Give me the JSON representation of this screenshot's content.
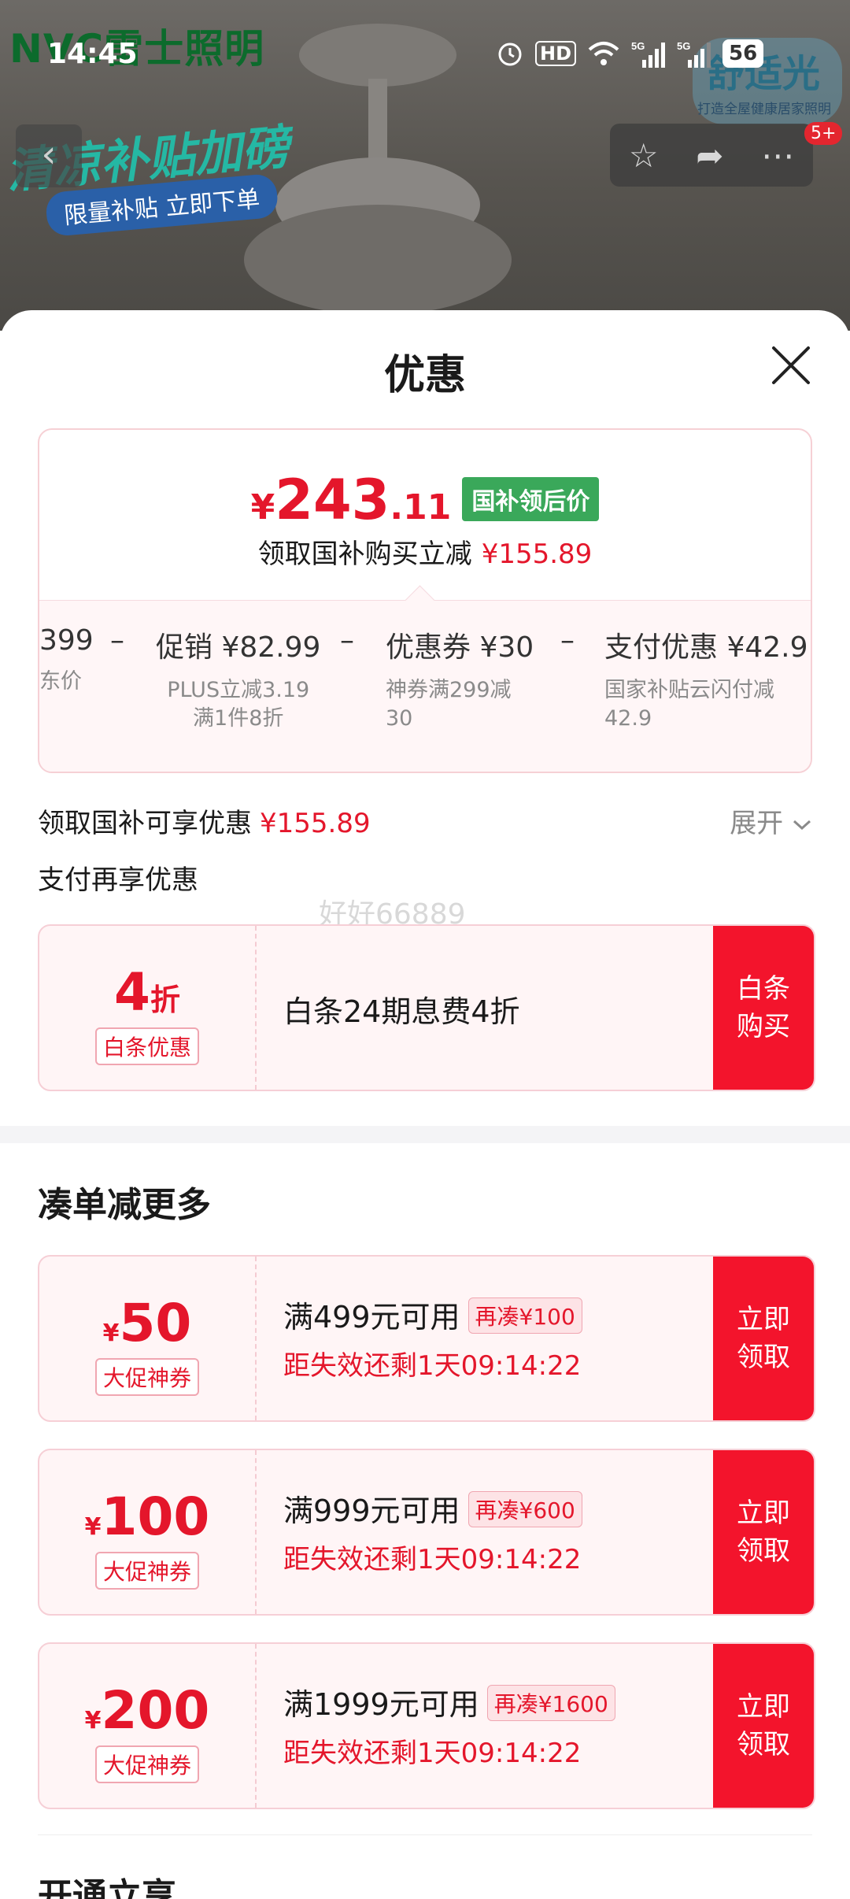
{
  "status_bar": {
    "time": "14:45",
    "icons": [
      "alarm-icon",
      "hd-icon",
      "wifi-icon",
      "signal-5g-icon",
      "signal-5g-icon"
    ],
    "hd_label": "HD",
    "battery": "56"
  },
  "background": {
    "brand_logo": "NVC雷士照明",
    "promo_title": "清凉补贴加磅",
    "promo_sub": "限量补贴 立即下单",
    "brand_badge_title": "舒适光",
    "brand_badge_sub": "打造全屋健康居家照明",
    "badge_count": "5+"
  },
  "sheet": {
    "title": "优惠",
    "close_icon": "close-icon"
  },
  "price_card": {
    "price_currency": "¥",
    "price_int": "243",
    "price_dec": ".11",
    "price_tag": "国补领后价",
    "subsidy_text": "领取国补购买立减",
    "subsidy_amount": "¥155.89",
    "breakdown": [
      {
        "top": "399",
        "sub": "东价"
      },
      {
        "top": "促销 ¥82.99",
        "sub": "PLUS立减3.19\n满1件8折"
      },
      {
        "top": "优惠券 ¥30",
        "sub": "神券满299减\n30"
      },
      {
        "top": "支付优惠 ¥42.9",
        "sub": "国家补贴云闪付减\n42.9"
      }
    ],
    "minus": "–"
  },
  "info": {
    "subsidy_label": "领取国补可享优惠",
    "subsidy_value": "¥155.89",
    "expand_label": "展开",
    "pay_label": "支付再享优惠",
    "watermark": "好好66889"
  },
  "baitiao": {
    "value": "4",
    "unit": "折",
    "tag": "白条优惠",
    "text": "白条24期息费4折",
    "button": "白条购买"
  },
  "section": {
    "title": "凑单减更多",
    "next_title": "开通立享"
  },
  "coupons": [
    {
      "currency": "¥",
      "value": "50",
      "tag": "大促神券",
      "title": "满499元可用",
      "extra": "再凑¥100",
      "time": "距失效还剩1天09:14:22",
      "button": "立即领取"
    },
    {
      "currency": "¥",
      "value": "100",
      "tag": "大促神券",
      "title": "满999元可用",
      "extra": "再凑¥600",
      "time": "距失效还剩1天09:14:22",
      "button": "立即领取"
    },
    {
      "currency": "¥",
      "value": "200",
      "tag": "大促神券",
      "title": "满1999元可用",
      "extra": "再凑¥1600",
      "time": "距失效还剩1天09:14:22",
      "button": "立即领取"
    }
  ],
  "colors": {
    "accent_red": "#e4162b",
    "button_red": "#f3142c",
    "green_tag": "#3aa85a"
  }
}
